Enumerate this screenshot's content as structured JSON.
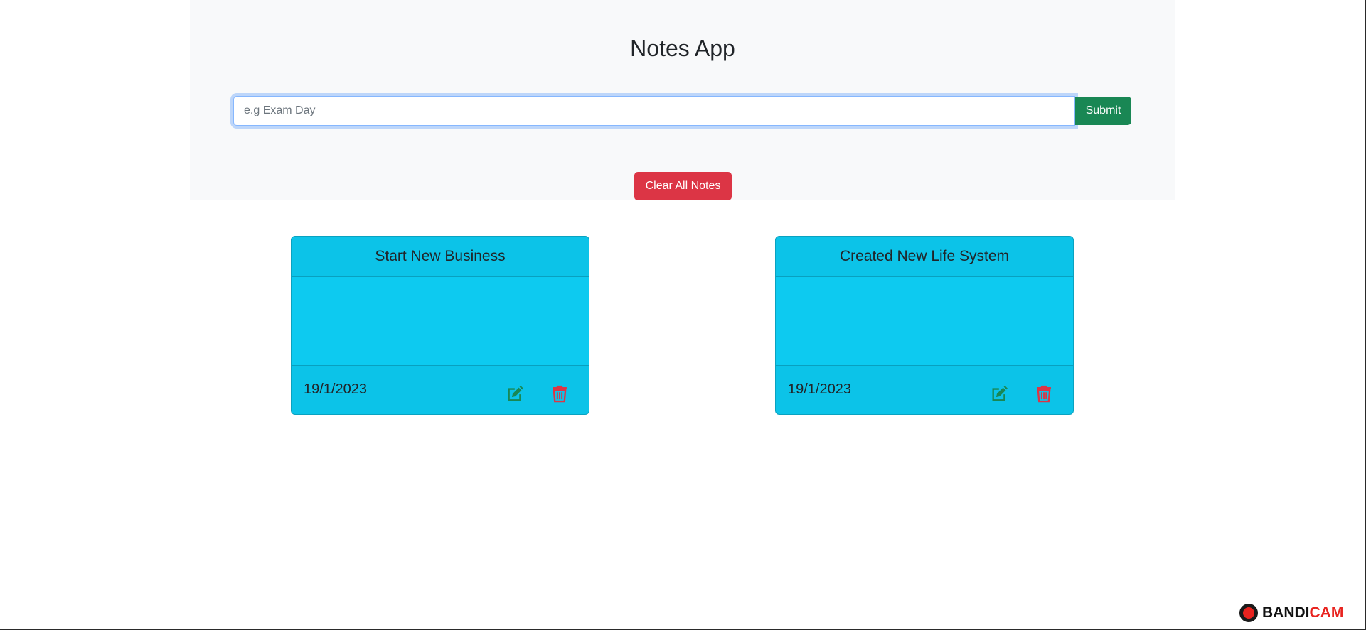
{
  "app": {
    "title": "Notes App"
  },
  "form": {
    "input_value": "",
    "placeholder": "e.g Exam Day",
    "submit_label": "Submit"
  },
  "actions": {
    "clear_all_label": "Clear All Notes"
  },
  "notes": [
    {
      "title": "Start New Business",
      "date": "19/1/2023"
    },
    {
      "title": "Created New Life System",
      "date": "19/1/2023"
    }
  ],
  "icons": {
    "edit": "edit-icon",
    "delete": "trash-icon"
  },
  "colors": {
    "card_bg": "#0dcaf0",
    "submit_bg": "#198754",
    "clear_bg": "#dc3545",
    "edit_icon": "#198754",
    "delete_icon": "#dc3545",
    "header_bg": "#f8f9fa"
  },
  "watermark": {
    "part1": "BANDI",
    "part2": "CAM"
  }
}
